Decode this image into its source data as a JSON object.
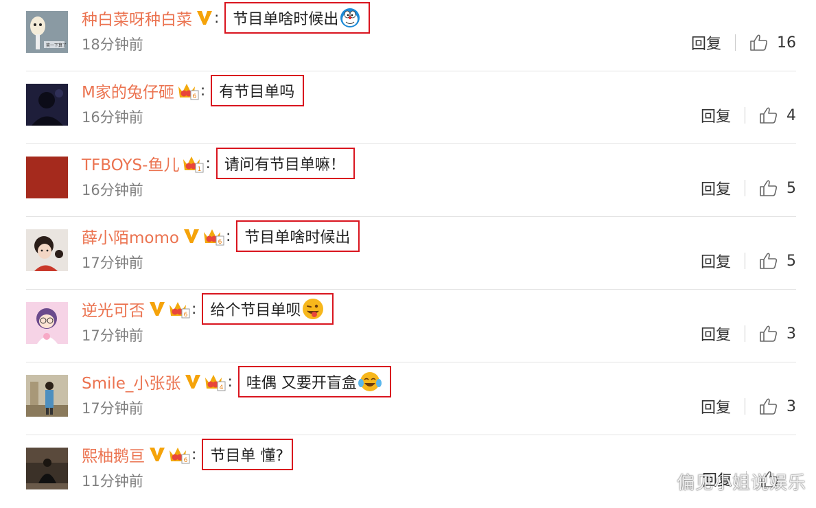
{
  "comments": [
    {
      "username": "种白菜呀种白菜",
      "text": "节目单啥时候出",
      "time": "18分钟前",
      "reply": "回复",
      "likes": "16",
      "verified": true,
      "crown": false,
      "crown_level": "",
      "emoji": "doraemon-emoji",
      "avatar": "egg-avatar"
    },
    {
      "username": "M家的兔仔砸",
      "text": "有节目单吗",
      "time": "16分钟前",
      "reply": "回复",
      "likes": "4",
      "verified": false,
      "crown": true,
      "crown_level": "6",
      "emoji": "",
      "avatar": "silhouette-avatar"
    },
    {
      "username": "TFBOYS-鱼儿",
      "text": "请问有节目单嘛！",
      "time": "16分钟前",
      "reply": "回复",
      "likes": "5",
      "verified": false,
      "crown": true,
      "crown_level": "1",
      "emoji": "",
      "avatar": "red-avatar"
    },
    {
      "username": "薛小陌momo",
      "text": "节目单啥时候出",
      "time": "17分钟前",
      "reply": "回复",
      "likes": "5",
      "verified": true,
      "crown": true,
      "crown_level": "6",
      "emoji": "",
      "avatar": "child-avatar"
    },
    {
      "username": "逆光可否",
      "text": "给个节目单呗",
      "time": "17分钟前",
      "reply": "回复",
      "likes": "3",
      "verified": true,
      "crown": true,
      "crown_level": "6",
      "emoji": "tongue-emoji",
      "avatar": "cartoon-avatar"
    },
    {
      "username": "Smile_小张张",
      "text": "哇偶 又要开盲盒",
      "time": "17分钟前",
      "reply": "回复",
      "likes": "3",
      "verified": true,
      "crown": true,
      "crown_level": "4",
      "emoji": "laugh-cry-emoji",
      "avatar": "stage-avatar"
    },
    {
      "username": "熙柚鹅亘",
      "text": "节目单 懂?",
      "time": "11分钟前",
      "reply": "回复",
      "likes": "",
      "verified": true,
      "crown": true,
      "crown_level": "6",
      "emoji": "",
      "avatar": "sitting-avatar"
    }
  ],
  "watermark": "偏见小姐说娱乐",
  "colors": {
    "username": "#eb7350",
    "highlight_box": "#d9141e",
    "verified_v": "#f5a30a",
    "crown": "#f2a90c",
    "time": "#808080"
  }
}
